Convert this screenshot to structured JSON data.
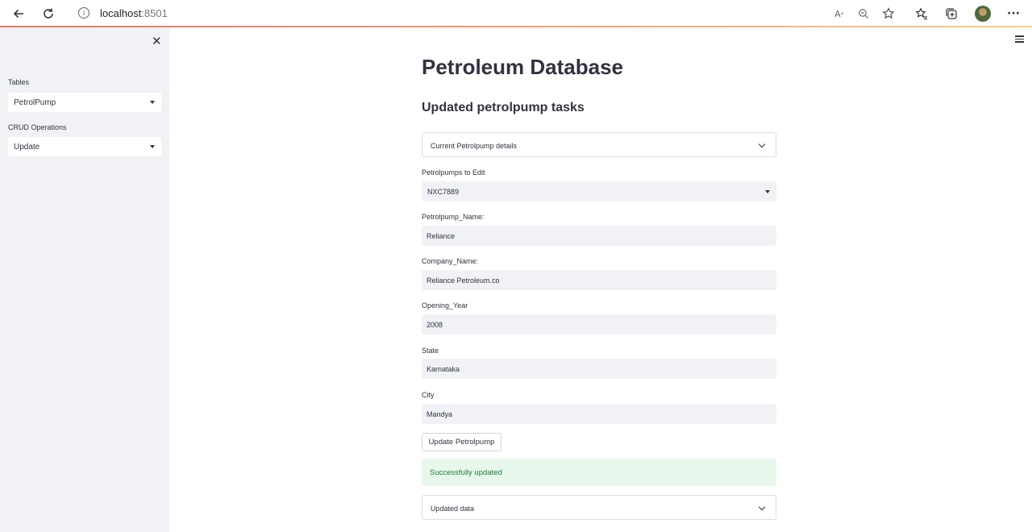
{
  "browser": {
    "url_host": "localhost",
    "url_port": ":8501"
  },
  "sidebar": {
    "tables_label": "Tables",
    "tables_value": "PetrolPump",
    "crud_label": "CRUD Operations",
    "crud_value": "Update"
  },
  "main": {
    "title": "Petroleum Database",
    "subtitle": "Updated petrolpump tasks",
    "current_details_expander": "Current Petrolpump details",
    "edit_select_label": "Petrolpumps to Edit",
    "edit_select_value": "NXC7889",
    "fields": [
      {
        "label": "Petrolpump_Name:",
        "value": "Reliance"
      },
      {
        "label": "Company_Name:",
        "value": "Reliance Petroleum.co"
      },
      {
        "label": "Opening_Year",
        "value": "2008"
      },
      {
        "label": "State",
        "value": "Karnataka"
      },
      {
        "label": "City",
        "value": "Mandya"
      }
    ],
    "update_button": "Update Petrolpump",
    "success_message": "Successfully updated",
    "updated_data_expander": "Updated data"
  },
  "colors": {
    "sidebar_bg": "#f0f2f6",
    "success_bg": "#e8f7ec",
    "success_text": "#1f7a3a"
  }
}
